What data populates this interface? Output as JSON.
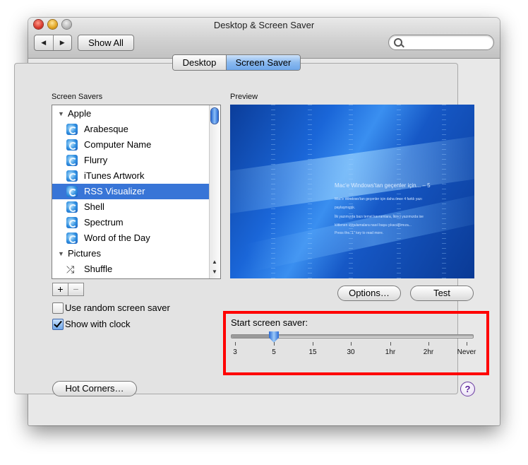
{
  "window": {
    "title": "Desktop & Screen Saver"
  },
  "toolbar": {
    "back": "◀",
    "forward": "▶",
    "show_all": "Show All",
    "search_placeholder": ""
  },
  "tabs": [
    {
      "label": "Desktop",
      "selected": false
    },
    {
      "label": "Screen Saver",
      "selected": true
    }
  ],
  "screen_savers": {
    "header": "Screen Savers",
    "items": [
      {
        "label": "Apple",
        "type": "group"
      },
      {
        "label": "Arabesque",
        "type": "item"
      },
      {
        "label": "Computer Name",
        "type": "item"
      },
      {
        "label": "Flurry",
        "type": "item"
      },
      {
        "label": "iTunes Artwork",
        "type": "item"
      },
      {
        "label": "RSS Visualizer",
        "type": "item",
        "selected": true
      },
      {
        "label": "Shell",
        "type": "item"
      },
      {
        "label": "Spectrum",
        "type": "item"
      },
      {
        "label": "Word of the Day",
        "type": "item"
      },
      {
        "label": "Pictures",
        "type": "group"
      },
      {
        "label": "Shuffle",
        "type": "item"
      }
    ],
    "add": "+",
    "remove": "−"
  },
  "options": {
    "random": {
      "label": "Use random screen saver",
      "checked": false
    },
    "clock": {
      "label": "Show with clock",
      "checked": true
    }
  },
  "preview": {
    "header": "Preview",
    "title": "Mac'e Windows'tan geçenler için... – 5",
    "lines": [
      "Mac'e Windows'tan geçenler için daha önce 4 farklı yazı",
      "paylaşmıştık.",
      "İlk yazımızda bazı temel kavramlara, İkinci yazımızda ise",
      "klitlenen uygulamalara nasıl başa çıkacağımıza...",
      "Press the \"1\" key to read more."
    ],
    "options_button": "Options…",
    "test_button": "Test"
  },
  "start_saver": {
    "label": "Start screen saver:",
    "ticks": [
      "3",
      "5",
      "15",
      "30",
      "1hr",
      "2hr",
      "Never"
    ],
    "selected": "5"
  },
  "hot_corners": "Hot Corners…",
  "help": "?",
  "colors": {
    "selection": "#3875d7",
    "highlight": "#ff0000"
  }
}
